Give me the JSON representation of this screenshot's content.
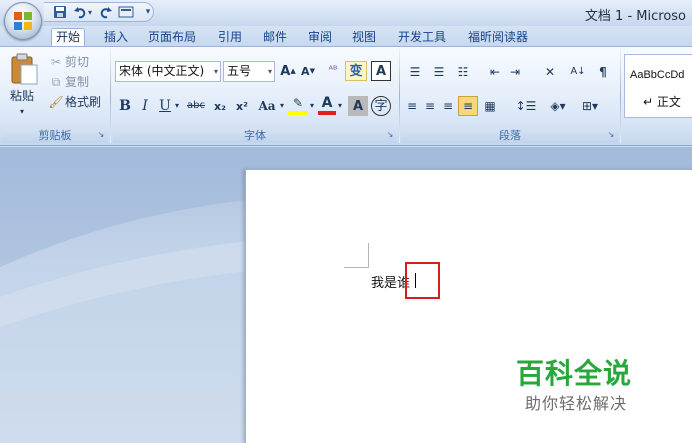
{
  "window": {
    "title": "文档 1 - Microso",
    "office_button_icon": "office-logo-icon"
  },
  "quick_access": {
    "save_icon": "save-icon",
    "undo_icon": "undo-icon",
    "redo_icon": "redo-icon",
    "print_preview_icon": "print-preview-icon",
    "customize_icon": "customize-qat-icon"
  },
  "tabs": [
    {
      "label": "开始",
      "active": true
    },
    {
      "label": "插入"
    },
    {
      "label": "页面布局"
    },
    {
      "label": "引用"
    },
    {
      "label": "邮件"
    },
    {
      "label": "审阅"
    },
    {
      "label": "视图"
    },
    {
      "label": "开发工具"
    },
    {
      "label": "福昕阅读器"
    }
  ],
  "clipboard": {
    "paste_label": "粘贴",
    "cut_label": "剪切",
    "copy_label": "复制",
    "format_painter_label": "格式刷",
    "group_label": "剪贴板"
  },
  "font": {
    "font_name": "宋体 (中文正文)",
    "font_size": "五号",
    "group_label": "字体",
    "bold": "B",
    "italic": "I",
    "underline": "U",
    "strikethrough": "abc",
    "subscript": "x₂",
    "superscript": "x²",
    "change_case": "Aa",
    "grow_font": "A",
    "shrink_font": "A",
    "char_shading": "A",
    "font_color": "A",
    "highlight_color": "ab"
  },
  "paragraph": {
    "group_label": "段落"
  },
  "styles": {
    "preview_text": "AaBbCcDd",
    "normal_style_label": "↵ 正文"
  },
  "document": {
    "text": "我是谁"
  },
  "watermark": {
    "title": "百科全说",
    "subtitle": "助你轻松解决"
  },
  "colors": {
    "highlight_box": "#d61e1e",
    "watermark_green": "#28a73b",
    "ribbon_text": "#15428b"
  }
}
